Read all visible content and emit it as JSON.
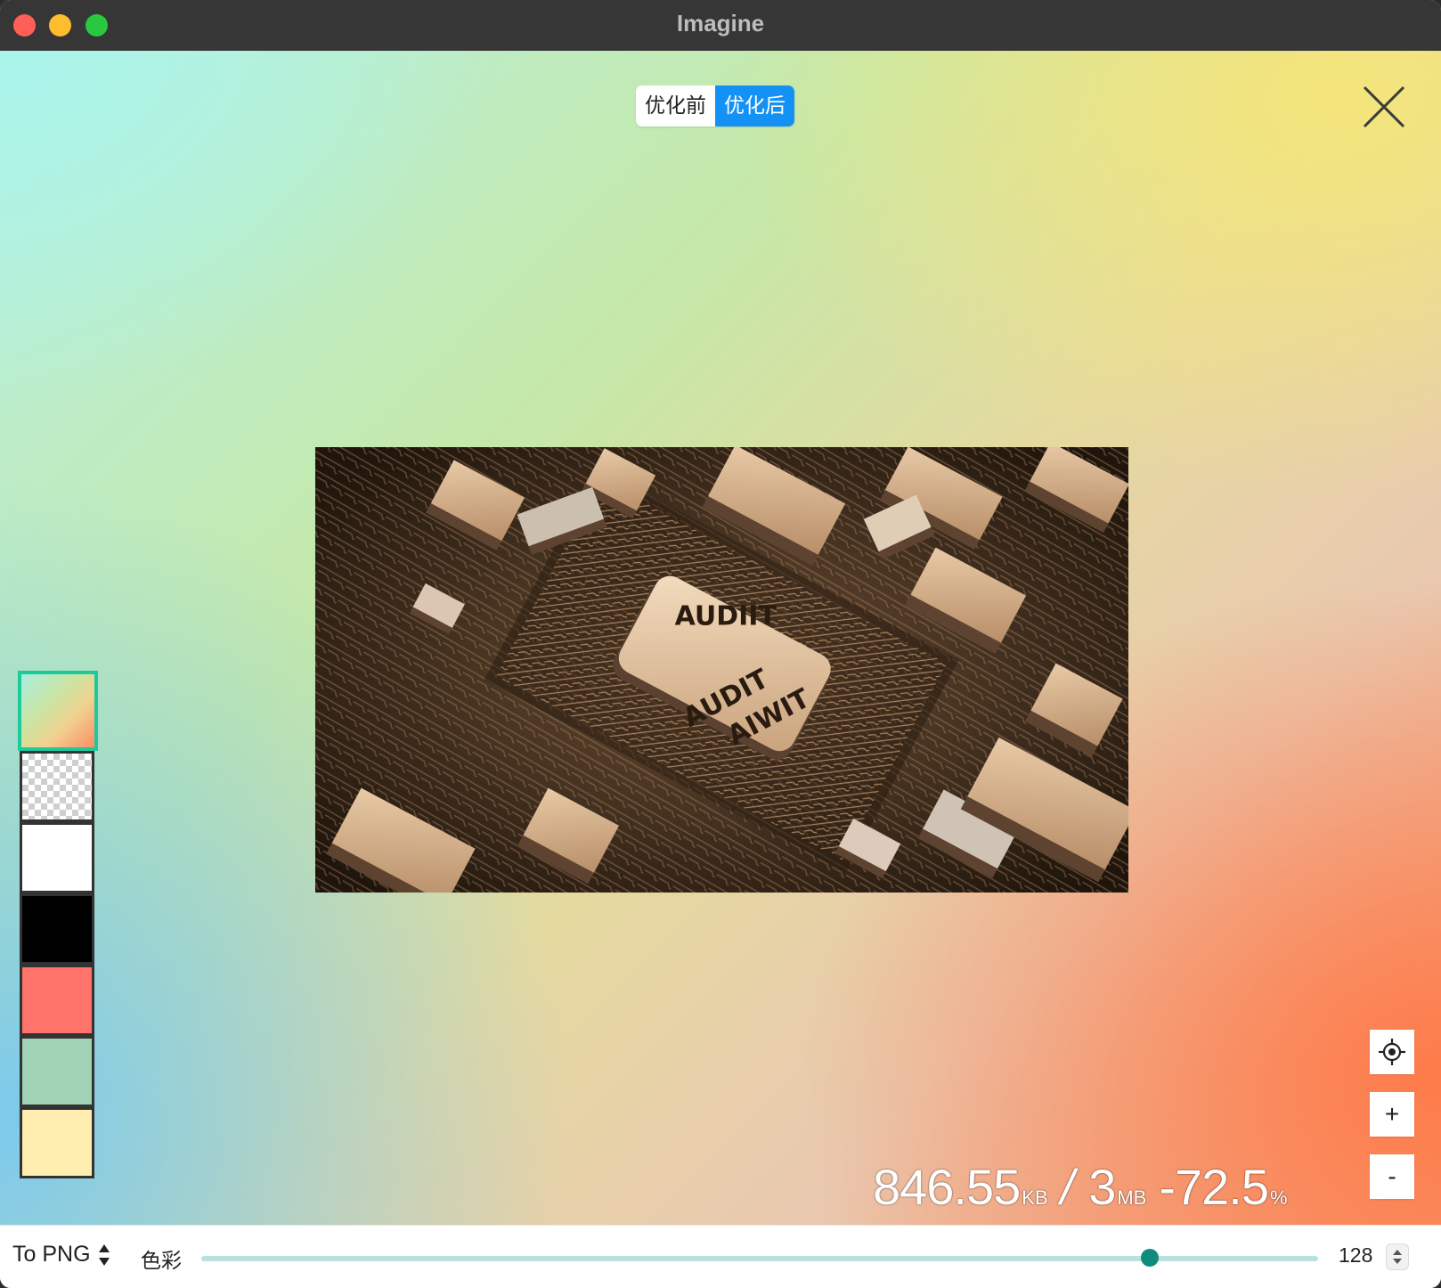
{
  "window": {
    "title": "Imagine"
  },
  "toggle": {
    "before": "优化前",
    "after": "优化后",
    "selected": "after"
  },
  "preview": {
    "chip_text_1": "AUDIIT",
    "chip_text_2": "AUDIT",
    "chip_text_3": "AIWIT"
  },
  "swatches": [
    {
      "name": "gradient",
      "color": "gradient",
      "selected": true
    },
    {
      "name": "transparent",
      "color": "checkerboard",
      "selected": false
    },
    {
      "name": "white",
      "color": "#ffffff",
      "selected": false
    },
    {
      "name": "black",
      "color": "#000000",
      "selected": false
    },
    {
      "name": "red",
      "color": "#ff736a",
      "selected": false
    },
    {
      "name": "green",
      "color": "#a0d3b5",
      "selected": false
    },
    {
      "name": "yellow",
      "color": "#ffeeb0",
      "selected": false
    }
  ],
  "zoom": {
    "locate": "locate-icon",
    "in": "+",
    "out": "-"
  },
  "stats": {
    "new_size": "846.55",
    "new_unit": "KB",
    "separator": "/",
    "old_size": "3",
    "old_unit": "MB",
    "change": "-72.5",
    "change_unit": "%"
  },
  "toolbar": {
    "format": "To PNG",
    "color_label": "色彩",
    "colors_value": "128",
    "colors_max": 256,
    "colors_min": 2,
    "accent": "#0f8c7e"
  }
}
